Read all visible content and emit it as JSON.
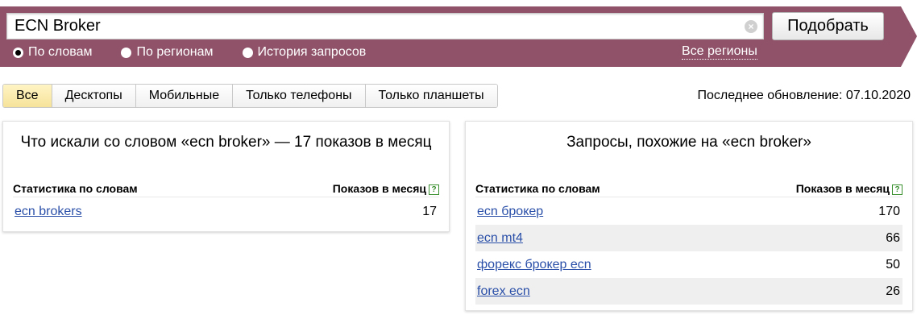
{
  "search": {
    "value": "ECN Broker",
    "clear_glyph": "×",
    "submit_label": "Подобрать"
  },
  "modes": [
    {
      "label": "По словам",
      "checked": true
    },
    {
      "label": "По регионам",
      "checked": false
    },
    {
      "label": "История запросов",
      "checked": false
    }
  ],
  "regions_link": "Все регионы",
  "device_tabs": [
    {
      "label": "Все",
      "active": true
    },
    {
      "label": "Десктопы",
      "active": false
    },
    {
      "label": "Мобильные",
      "active": false
    },
    {
      "label": "Только телефоны",
      "active": false
    },
    {
      "label": "Только планшеты",
      "active": false
    }
  ],
  "last_update": "Последнее обновление: 07.10.2020",
  "left_panel": {
    "title": "Что искали со словом «ecn broker» — 17 показов в месяц",
    "col_words": "Статистика по словам",
    "col_shows": "Показов в месяц",
    "help_glyph": "?",
    "rows": [
      {
        "query": "ecn brokers",
        "count": "17"
      }
    ]
  },
  "right_panel": {
    "title": "Запросы, похожие на «ecn broker»",
    "col_words": "Статистика по словам",
    "col_shows": "Показов в месяц",
    "help_glyph": "?",
    "rows": [
      {
        "query": "ecn брокер",
        "count": "170"
      },
      {
        "query": "ecn mt4",
        "count": "66"
      },
      {
        "query": "форекс брокер ecn",
        "count": "50"
      },
      {
        "query": "forex ecn",
        "count": "26"
      }
    ]
  },
  "colors": {
    "header_band": "#8f5269",
    "active_tab": "#f6e39a",
    "link": "#2a4fa8",
    "help_icon": "#3a8f2f"
  }
}
